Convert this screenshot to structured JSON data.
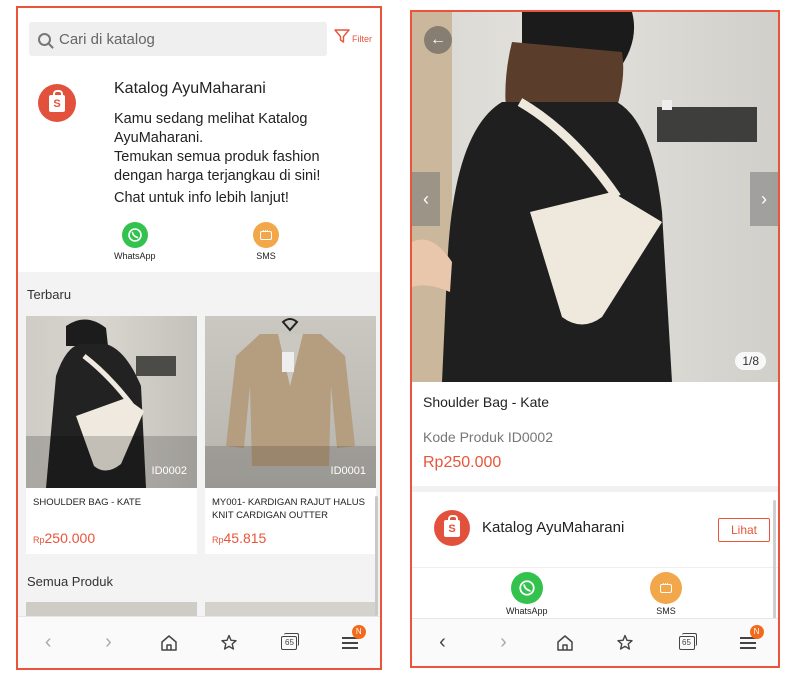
{
  "left": {
    "search": {
      "placeholder": "Cari di katalog"
    },
    "filter_label": "Filter",
    "store": {
      "name": "Katalog AyuMaharani",
      "description": "Kamu sedang melihat Katalog AyuMaharani.\nTemukan semua produk fashion dengan harga terjangkau di sini!",
      "chat_prompt": "Chat untuk info lebih lanjut!",
      "logo_letter": "S",
      "contacts": [
        {
          "label": "WhatsApp",
          "icon": "whatsapp-icon"
        },
        {
          "label": "SMS",
          "icon": "sms-icon"
        }
      ]
    },
    "sections": {
      "newest": "Terbaru",
      "all": "Semua Produk"
    },
    "products": [
      {
        "id": "ID0002",
        "name": "SHOULDER BAG - KATE",
        "currency": "Rp",
        "price": "250.000"
      },
      {
        "id": "ID0001",
        "name": "MY001- KARDIGAN RAJUT HALUS KNIT CARDIGAN OUTTER",
        "currency": "Rp",
        "price": "45.815"
      }
    ]
  },
  "right": {
    "image_counter": "1/8",
    "product": {
      "title": "Shoulder Bag - Kate",
      "code": "Kode Produk ID0002",
      "price": "Rp250.000"
    },
    "store": {
      "name": "Katalog AyuMaharani",
      "view_button": "Lihat",
      "logo_letter": "S"
    },
    "contacts": [
      {
        "label": "WhatsApp",
        "icon": "whatsapp-icon"
      },
      {
        "label": "SMS",
        "icon": "sms-icon"
      }
    ]
  },
  "nav": {
    "tab_count": "65",
    "menu_badge": "N",
    "icons": [
      "back-icon",
      "forward-icon",
      "home-icon",
      "bookmark-star-icon",
      "tabs-icon",
      "menu-icon"
    ]
  },
  "colors": {
    "accent": "#e8553a",
    "whatsapp": "#32c24d",
    "sms": "#f2a84a",
    "badge": "#f26a1b"
  }
}
